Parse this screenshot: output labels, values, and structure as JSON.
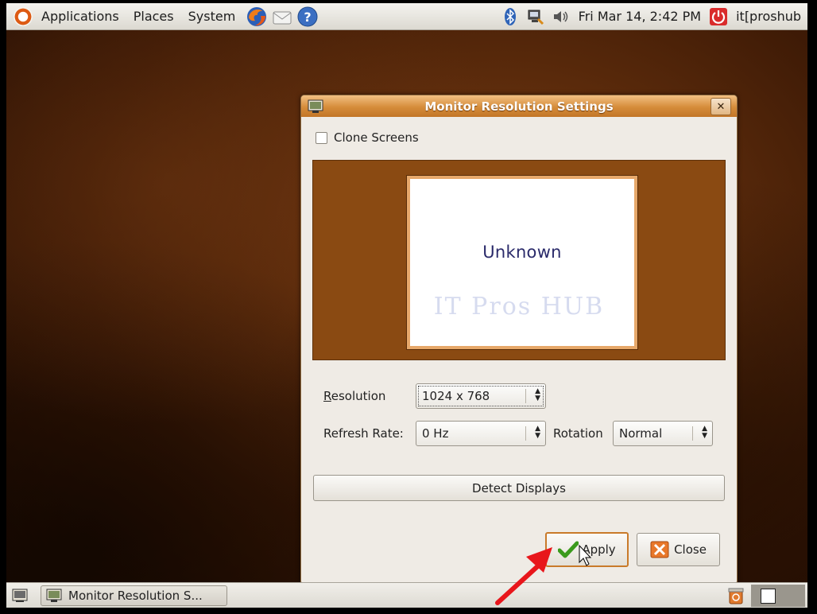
{
  "top_panel": {
    "menus": [
      "Applications",
      "Places",
      "System"
    ],
    "launchers": [
      "firefox-icon",
      "mail-icon",
      "help-icon"
    ],
    "tray_icons": [
      "bluetooth-icon",
      "network-icon",
      "volume-icon"
    ],
    "clock": "Fri Mar 14,  2:42 PM",
    "user": "it[proshub"
  },
  "dialog": {
    "title": "Monitor Resolution Settings",
    "clone_label": "Clone Screens",
    "clone_checked": false,
    "monitor_name": "Unknown",
    "watermark": "IT Pros HUB",
    "resolution_label": "Resolution",
    "resolution_value": "1024 x 768",
    "refresh_label": "Refresh Rate:",
    "refresh_value": "0 Hz",
    "rotation_label": "Rotation",
    "rotation_value": "Normal",
    "detect_label": "Detect Displays",
    "apply_label": "Apply",
    "close_label": "Close"
  },
  "bottom_panel": {
    "task_label": "Monitor Resolution S..."
  },
  "colors": {
    "titlebar": "#d58c3a",
    "preview_bg": "#8a4a12",
    "arrow": "#e8161b"
  }
}
